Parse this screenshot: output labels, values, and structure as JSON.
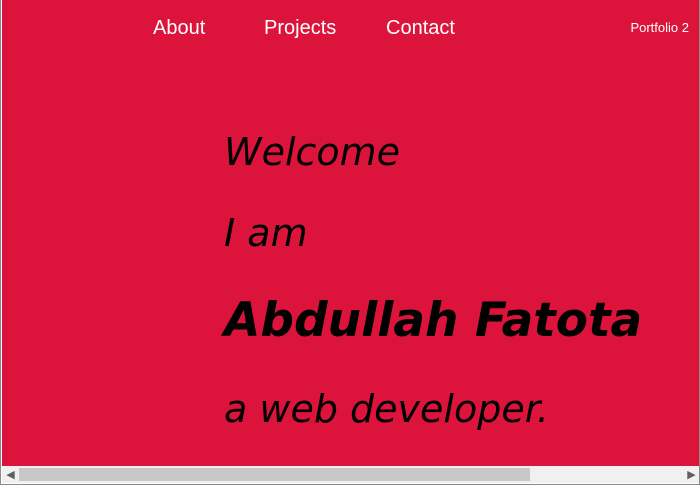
{
  "nav": {
    "items": [
      {
        "label": "About"
      },
      {
        "label": "Projects"
      },
      {
        "label": "Contact"
      }
    ],
    "brand": "Portfolio 2"
  },
  "hero": {
    "line1": "Welcome",
    "line2": "I am",
    "name": "Abdullah Fatota",
    "role": "a web developer."
  },
  "icons": {
    "scroll_left": "chevron-left-icon",
    "scroll_right": "chevron-right-icon"
  },
  "colors": {
    "background": "#DC143C",
    "nav_text": "#FFFFFF",
    "hero_text": "#000000"
  },
  "scrollbar": {
    "visible_fraction": 0.77,
    "position_fraction": 0.0
  }
}
